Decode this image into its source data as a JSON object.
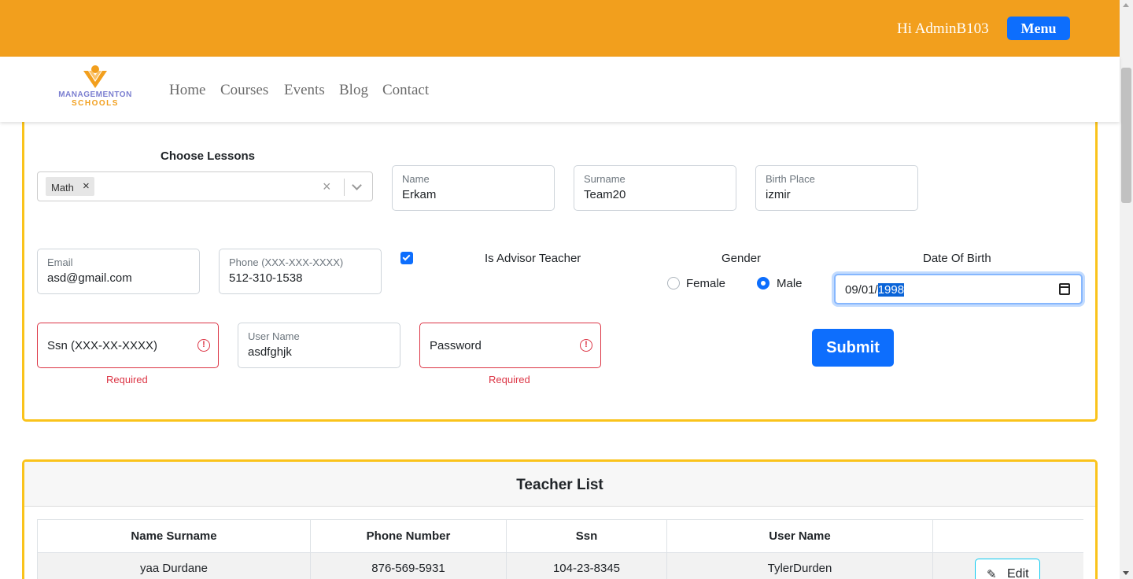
{
  "header": {
    "greeting": "Hi AdminB103",
    "menu_label": "Menu",
    "accent_color": "#f29f1d"
  },
  "nav": {
    "logo_line1": "MANAGEMENTON",
    "logo_line2": "SCHOOLS",
    "links": [
      "Home",
      "Courses",
      "Events",
      "Blog",
      "Contact"
    ]
  },
  "form": {
    "choose_lessons_label": "Choose Lessons",
    "selected_lessons": [
      "Math"
    ],
    "chip_remove": "×",
    "clear_icon": "×",
    "name": {
      "label": "Name",
      "value": "Erkam"
    },
    "surname": {
      "label": "Surname",
      "value": "Team20"
    },
    "birth_place": {
      "label": "Birth Place",
      "value": "izmir"
    },
    "email": {
      "label": "Email",
      "value": "asd@gmail.com"
    },
    "phone": {
      "label": "Phone (XXX-XXX-XXXX)",
      "value": "512-310-1538"
    },
    "advisor": {
      "label": "Is Advisor Teacher",
      "checked": true
    },
    "gender": {
      "label": "Gender",
      "options": [
        "Female",
        "Male"
      ],
      "selected": "Male"
    },
    "dob": {
      "label": "Date Of Birth",
      "value_prefix": "09/01/",
      "value_selected": "1998"
    },
    "ssn": {
      "placeholder": "Ssn (XXX-XX-XXXX)",
      "error": "Required"
    },
    "username": {
      "label": "User Name",
      "value": "asdfghjk"
    },
    "password": {
      "placeholder": "Password",
      "error": "Required"
    },
    "error_icon": "!",
    "submit_label": "Submit"
  },
  "teacher_list": {
    "title": "Teacher List",
    "columns": [
      "Name Surname",
      "Phone Number",
      "Ssn",
      "User Name",
      ""
    ],
    "rows": [
      {
        "name": "yaa Durdane",
        "phone": "876-569-5931",
        "ssn": "104-23-8345",
        "username": "TylerDurden",
        "action": "Edit"
      }
    ]
  }
}
